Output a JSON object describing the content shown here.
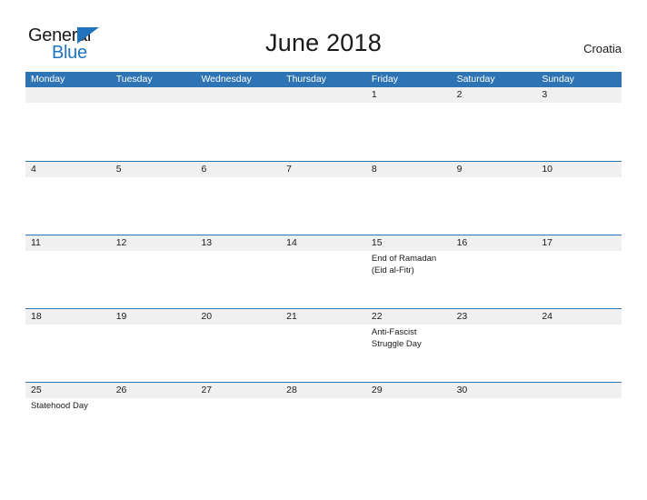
{
  "brand": {
    "word_one": "General",
    "word_two": "Blue",
    "accent_color": "#1f74bd",
    "flag_icon": "blue-triangle-flag-icon"
  },
  "header": {
    "title": "June 2018",
    "country": "Croatia"
  },
  "calendar": {
    "header_color": "#2e74b5",
    "band_color": "#f0f0f0",
    "weekdays": [
      "Monday",
      "Tuesday",
      "Wednesday",
      "Thursday",
      "Friday",
      "Saturday",
      "Sunday"
    ],
    "weeks": [
      {
        "days": [
          {
            "num": "",
            "events": []
          },
          {
            "num": "",
            "events": []
          },
          {
            "num": "",
            "events": []
          },
          {
            "num": "",
            "events": []
          },
          {
            "num": "1",
            "events": []
          },
          {
            "num": "2",
            "events": []
          },
          {
            "num": "3",
            "events": []
          }
        ]
      },
      {
        "days": [
          {
            "num": "4",
            "events": []
          },
          {
            "num": "5",
            "events": []
          },
          {
            "num": "6",
            "events": []
          },
          {
            "num": "7",
            "events": []
          },
          {
            "num": "8",
            "events": []
          },
          {
            "num": "9",
            "events": []
          },
          {
            "num": "10",
            "events": []
          }
        ]
      },
      {
        "days": [
          {
            "num": "11",
            "events": []
          },
          {
            "num": "12",
            "events": []
          },
          {
            "num": "13",
            "events": []
          },
          {
            "num": "14",
            "events": []
          },
          {
            "num": "15",
            "events": [
              "End of Ramadan",
              "(Eid al-Fitr)"
            ]
          },
          {
            "num": "16",
            "events": []
          },
          {
            "num": "17",
            "events": []
          }
        ]
      },
      {
        "days": [
          {
            "num": "18",
            "events": []
          },
          {
            "num": "19",
            "events": []
          },
          {
            "num": "20",
            "events": []
          },
          {
            "num": "21",
            "events": []
          },
          {
            "num": "22",
            "events": [
              "Anti-Fascist",
              "Struggle Day"
            ]
          },
          {
            "num": "23",
            "events": []
          },
          {
            "num": "24",
            "events": []
          }
        ]
      },
      {
        "days": [
          {
            "num": "25",
            "events": [
              "Statehood Day"
            ]
          },
          {
            "num": "26",
            "events": []
          },
          {
            "num": "27",
            "events": []
          },
          {
            "num": "28",
            "events": []
          },
          {
            "num": "29",
            "events": []
          },
          {
            "num": "30",
            "events": []
          },
          {
            "num": "",
            "events": []
          }
        ]
      }
    ]
  }
}
